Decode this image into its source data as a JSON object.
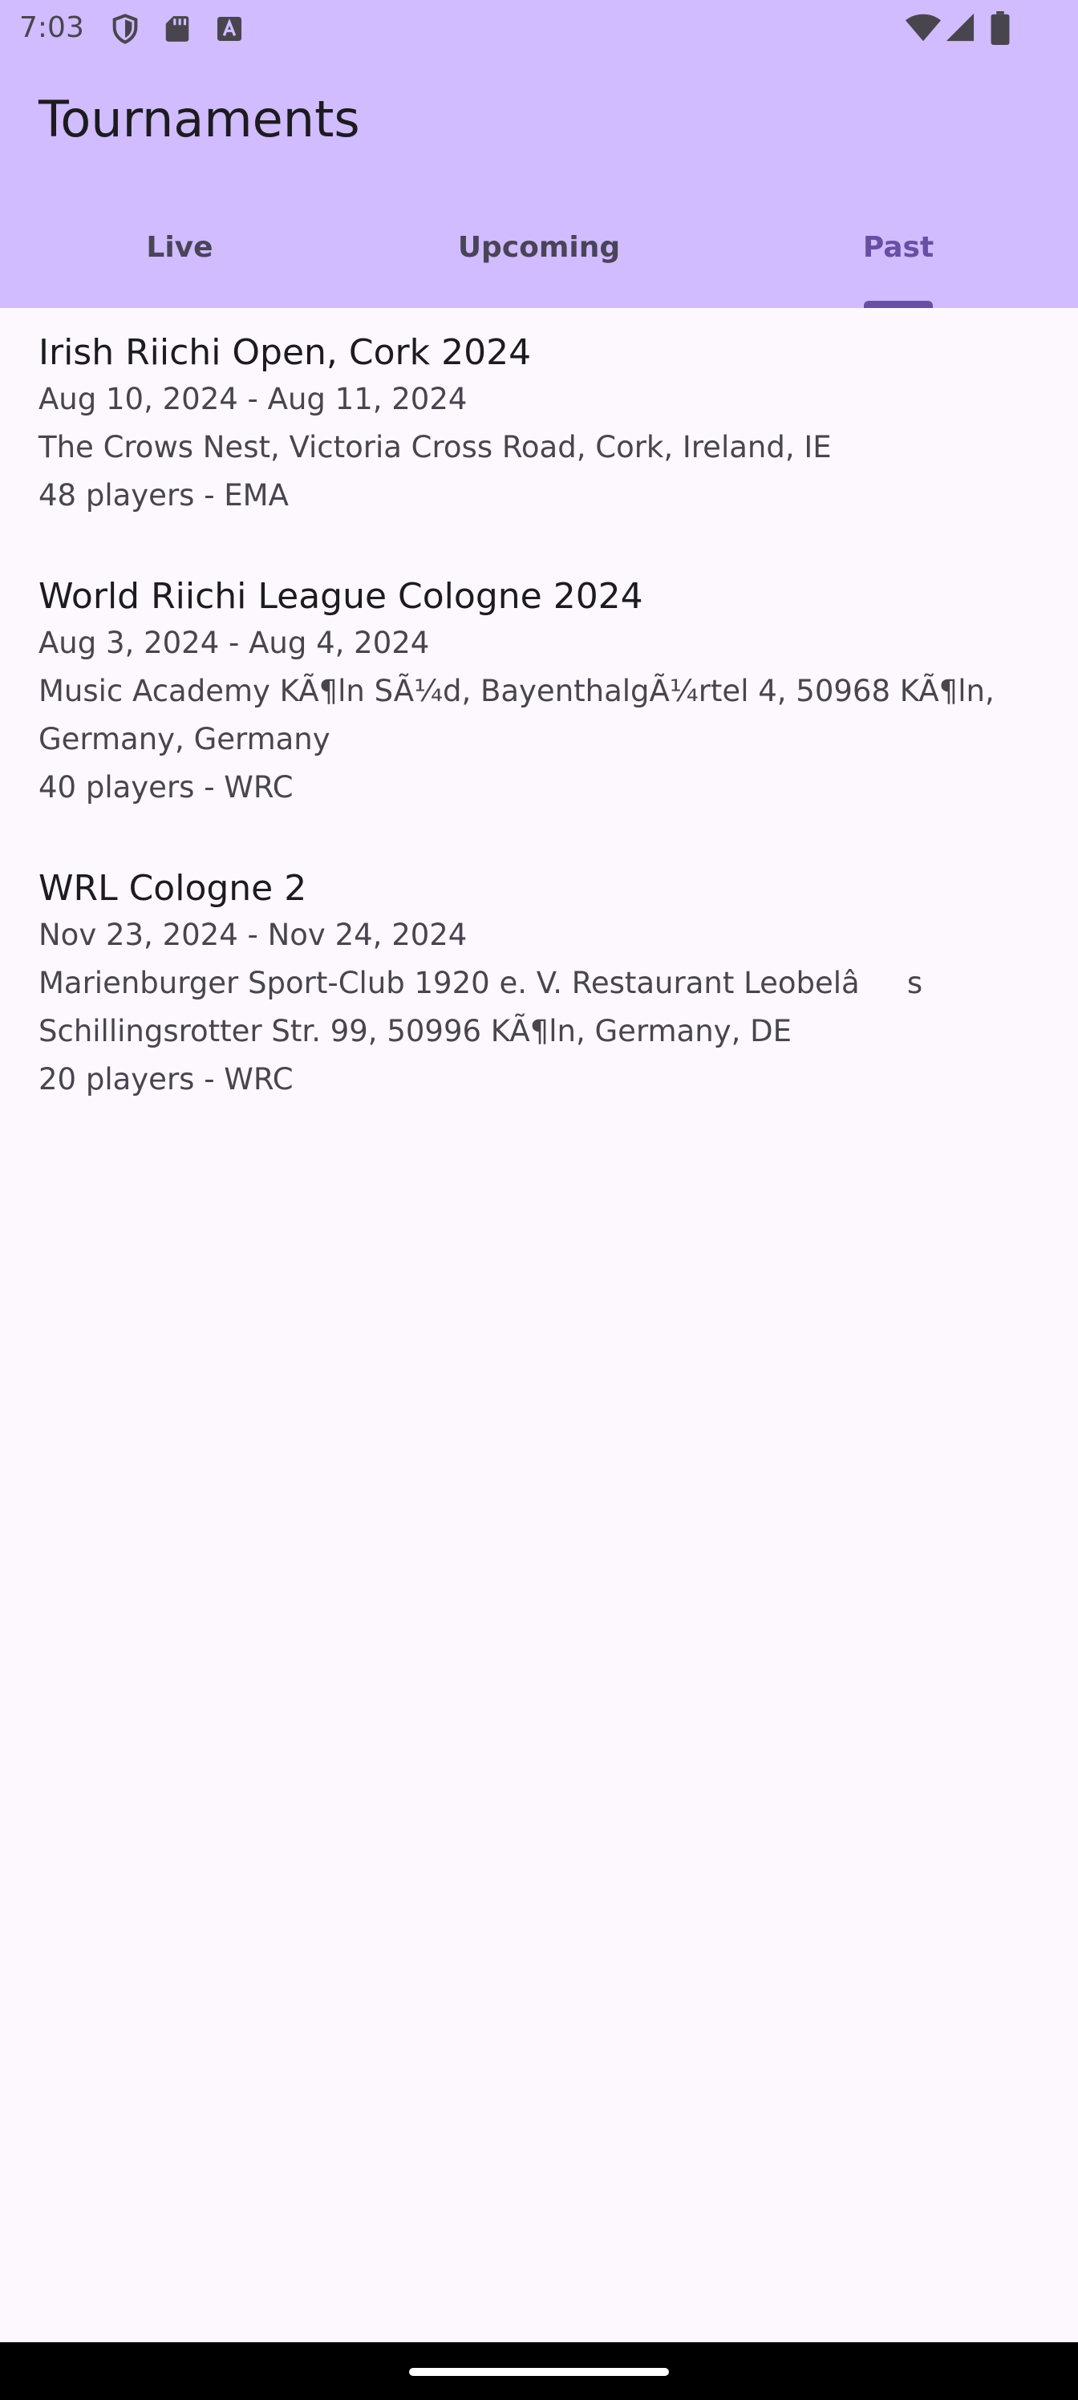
{
  "status_bar": {
    "time": "7:03",
    "left_icons": [
      "shield-icon",
      "sd-card-icon",
      "text-a-icon"
    ],
    "right_icons": [
      "wifi-icon",
      "signal-icon",
      "battery-icon"
    ]
  },
  "app_bar": {
    "title": "Tournaments"
  },
  "tabs": [
    {
      "label": "Live",
      "active": false
    },
    {
      "label": "Upcoming",
      "active": false
    },
    {
      "label": "Past",
      "active": true
    }
  ],
  "tournaments": [
    {
      "name": "Irish Riichi Open, Cork 2024",
      "dates": "Aug 10, 2024 - Aug 11, 2024",
      "location": "The Crows Nest, Victoria Cross Road, Cork, Ireland, IE",
      "location_line2": "",
      "players": "48 players - EMA"
    },
    {
      "name": "World Riichi League Cologne 2024",
      "dates": "Aug 3, 2024 - Aug 4, 2024",
      "location": "Music Academy KÃ¶ln SÃ¼d, BayenthalgÃ¼rtel 4, 50968 KÃ¶ln,",
      "location_line2": "Germany, Germany",
      "players": "40 players - WRC"
    },
    {
      "name": "WRL Cologne 2",
      "dates": "Nov 23, 2024 - Nov 24, 2024",
      "location": "Marienburger Sport-Club 1920 e. V. Restaurant Leobelâs",
      "location_line2": "Schillingsrotter Str. 99, 50996 KÃ¶ln, Germany, DE",
      "players": "20 players - WRC"
    }
  ],
  "colors": {
    "header_bg": "#d0bcff",
    "accent": "#6750a4",
    "page_bg": "#fdf7fe"
  }
}
